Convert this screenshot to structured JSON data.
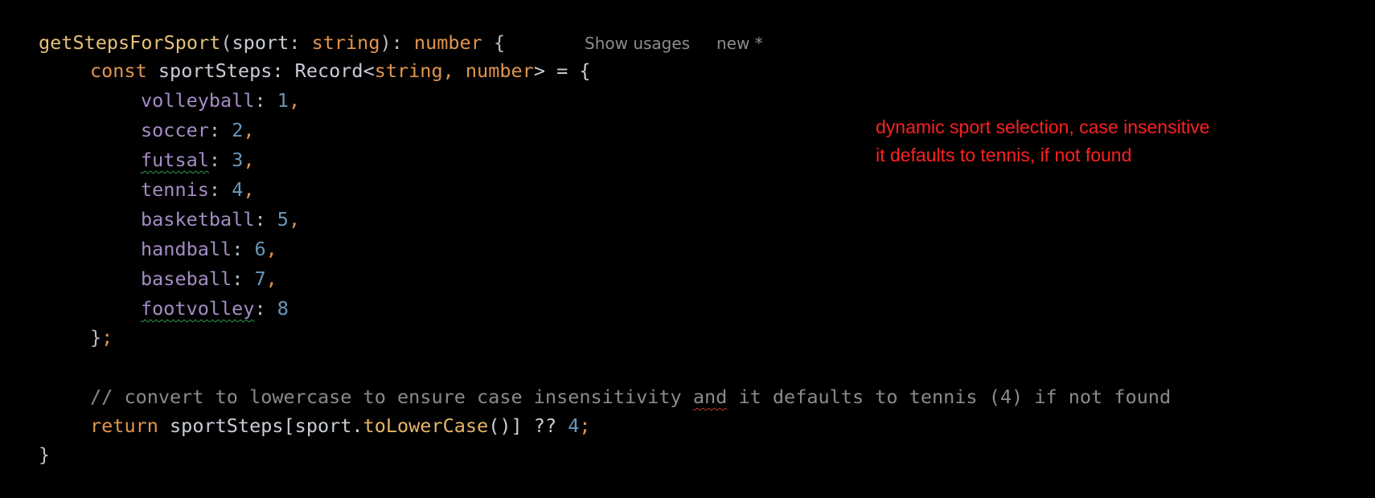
{
  "code": {
    "signature": {
      "name": "getStepsForSport",
      "open": "(",
      "param": "sport",
      "colon": ": ",
      "param_type": "string",
      "close": "): ",
      "return_type": "number",
      "brace": " {"
    },
    "inlay_hints": {
      "usages": "Show usages",
      "author": "new *"
    },
    "const_line": {
      "keyword": "const",
      "name": " sportSteps: Record<",
      "type1": "string",
      "comma": ",",
      "type2": " number",
      "rest": "> = {"
    },
    "entries": [
      {
        "key": "volleyball",
        "value": "1",
        "sep": ","
      },
      {
        "key": "soccer",
        "value": "2",
        "sep": ","
      },
      {
        "key": "futsal",
        "value": "3",
        "sep": ","
      },
      {
        "key": "tennis",
        "value": "4",
        "sep": ","
      },
      {
        "key": "basketball",
        "value": "5",
        "sep": ","
      },
      {
        "key": "handball",
        "value": "6",
        "sep": ","
      },
      {
        "key": "baseball",
        "value": "7",
        "sep": ","
      },
      {
        "key": "footvolley",
        "value": "8",
        "sep": ""
      }
    ],
    "entry_colon": ": ",
    "object_close": "}",
    "semicolon": ";",
    "comment_part1": "// convert to lowercase to ensure case insensitivity ",
    "comment_and": "and",
    "comment_part2": " it defaults to tennis (4) if not found",
    "return_line": {
      "keyword": "return",
      "expr": " sportSteps[sport.",
      "method": "toLowerCase",
      "after": "()] ?? ",
      "value": "4",
      "semicolon": ";"
    },
    "fn_close": "}"
  },
  "annotation": {
    "line1": "dynamic sport selection, case insensitive",
    "line2": "it defaults to tennis, if not found"
  },
  "colors": {
    "background": "#000000",
    "function_name": "#e5c07b",
    "keyword": "#e0954f",
    "property": "#a48cc4",
    "number": "#6897bb",
    "comment": "#8a8a8a",
    "annotation": "#ff2020"
  }
}
